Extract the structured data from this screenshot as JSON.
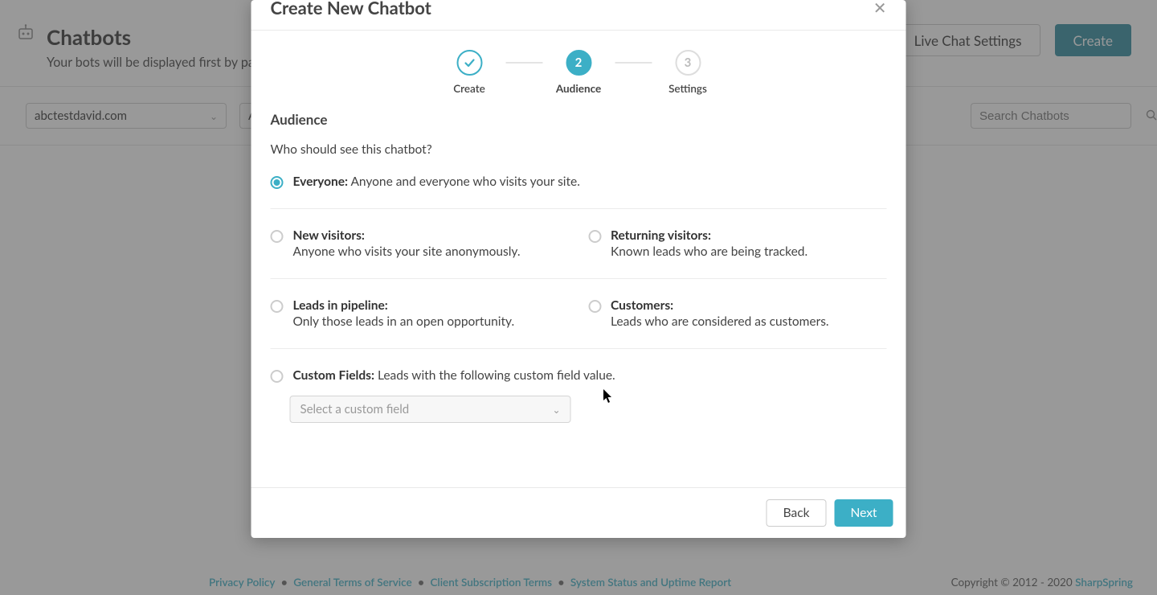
{
  "page": {
    "title": "Chatbots",
    "subtitle": "Your bots will be displayed first by page, and",
    "liveChatSettings": "Live Chat Settings",
    "createBtn": "Create"
  },
  "filters": {
    "domainSelect": "abctestdavid.com",
    "secondSelect": "A",
    "searchPlaceholder": "Search Chatbots"
  },
  "modal": {
    "title": "Create New Chatbot",
    "stepper": {
      "step1": "Create",
      "step2": "Audience",
      "step3": "Settings",
      "step2Num": "2",
      "step3Num": "3"
    },
    "sectionTitle": "Audience",
    "question": "Who should see this chatbot?",
    "options": {
      "everyone": {
        "label": "Everyone:",
        "desc": "Anyone and everyone who visits your site."
      },
      "newVisitors": {
        "label": "New visitors:",
        "desc": "Anyone who visits your site anonymously."
      },
      "returningVisitors": {
        "label": "Returning visitors:",
        "desc": "Known leads who are being tracked."
      },
      "leadsPipeline": {
        "label": "Leads in pipeline:",
        "desc": "Only those leads in an open opportunity."
      },
      "customers": {
        "label": "Customers:",
        "desc": "Leads who are considered as customers."
      },
      "customFields": {
        "label": "Custom Fields:",
        "desc": "Leads with the following custom field value."
      }
    },
    "customSelectPlaceholder": "Select a custom field",
    "backBtn": "Back",
    "nextBtn": "Next"
  },
  "footer": {
    "privacy": "Privacy Policy",
    "terms": "General Terms of Service",
    "clientSub": "Client Subscription Terms",
    "status": "System Status and Uptime Report",
    "copyright": "Copyright © 2012 - 2020 ",
    "brand": "SharpSpring"
  }
}
